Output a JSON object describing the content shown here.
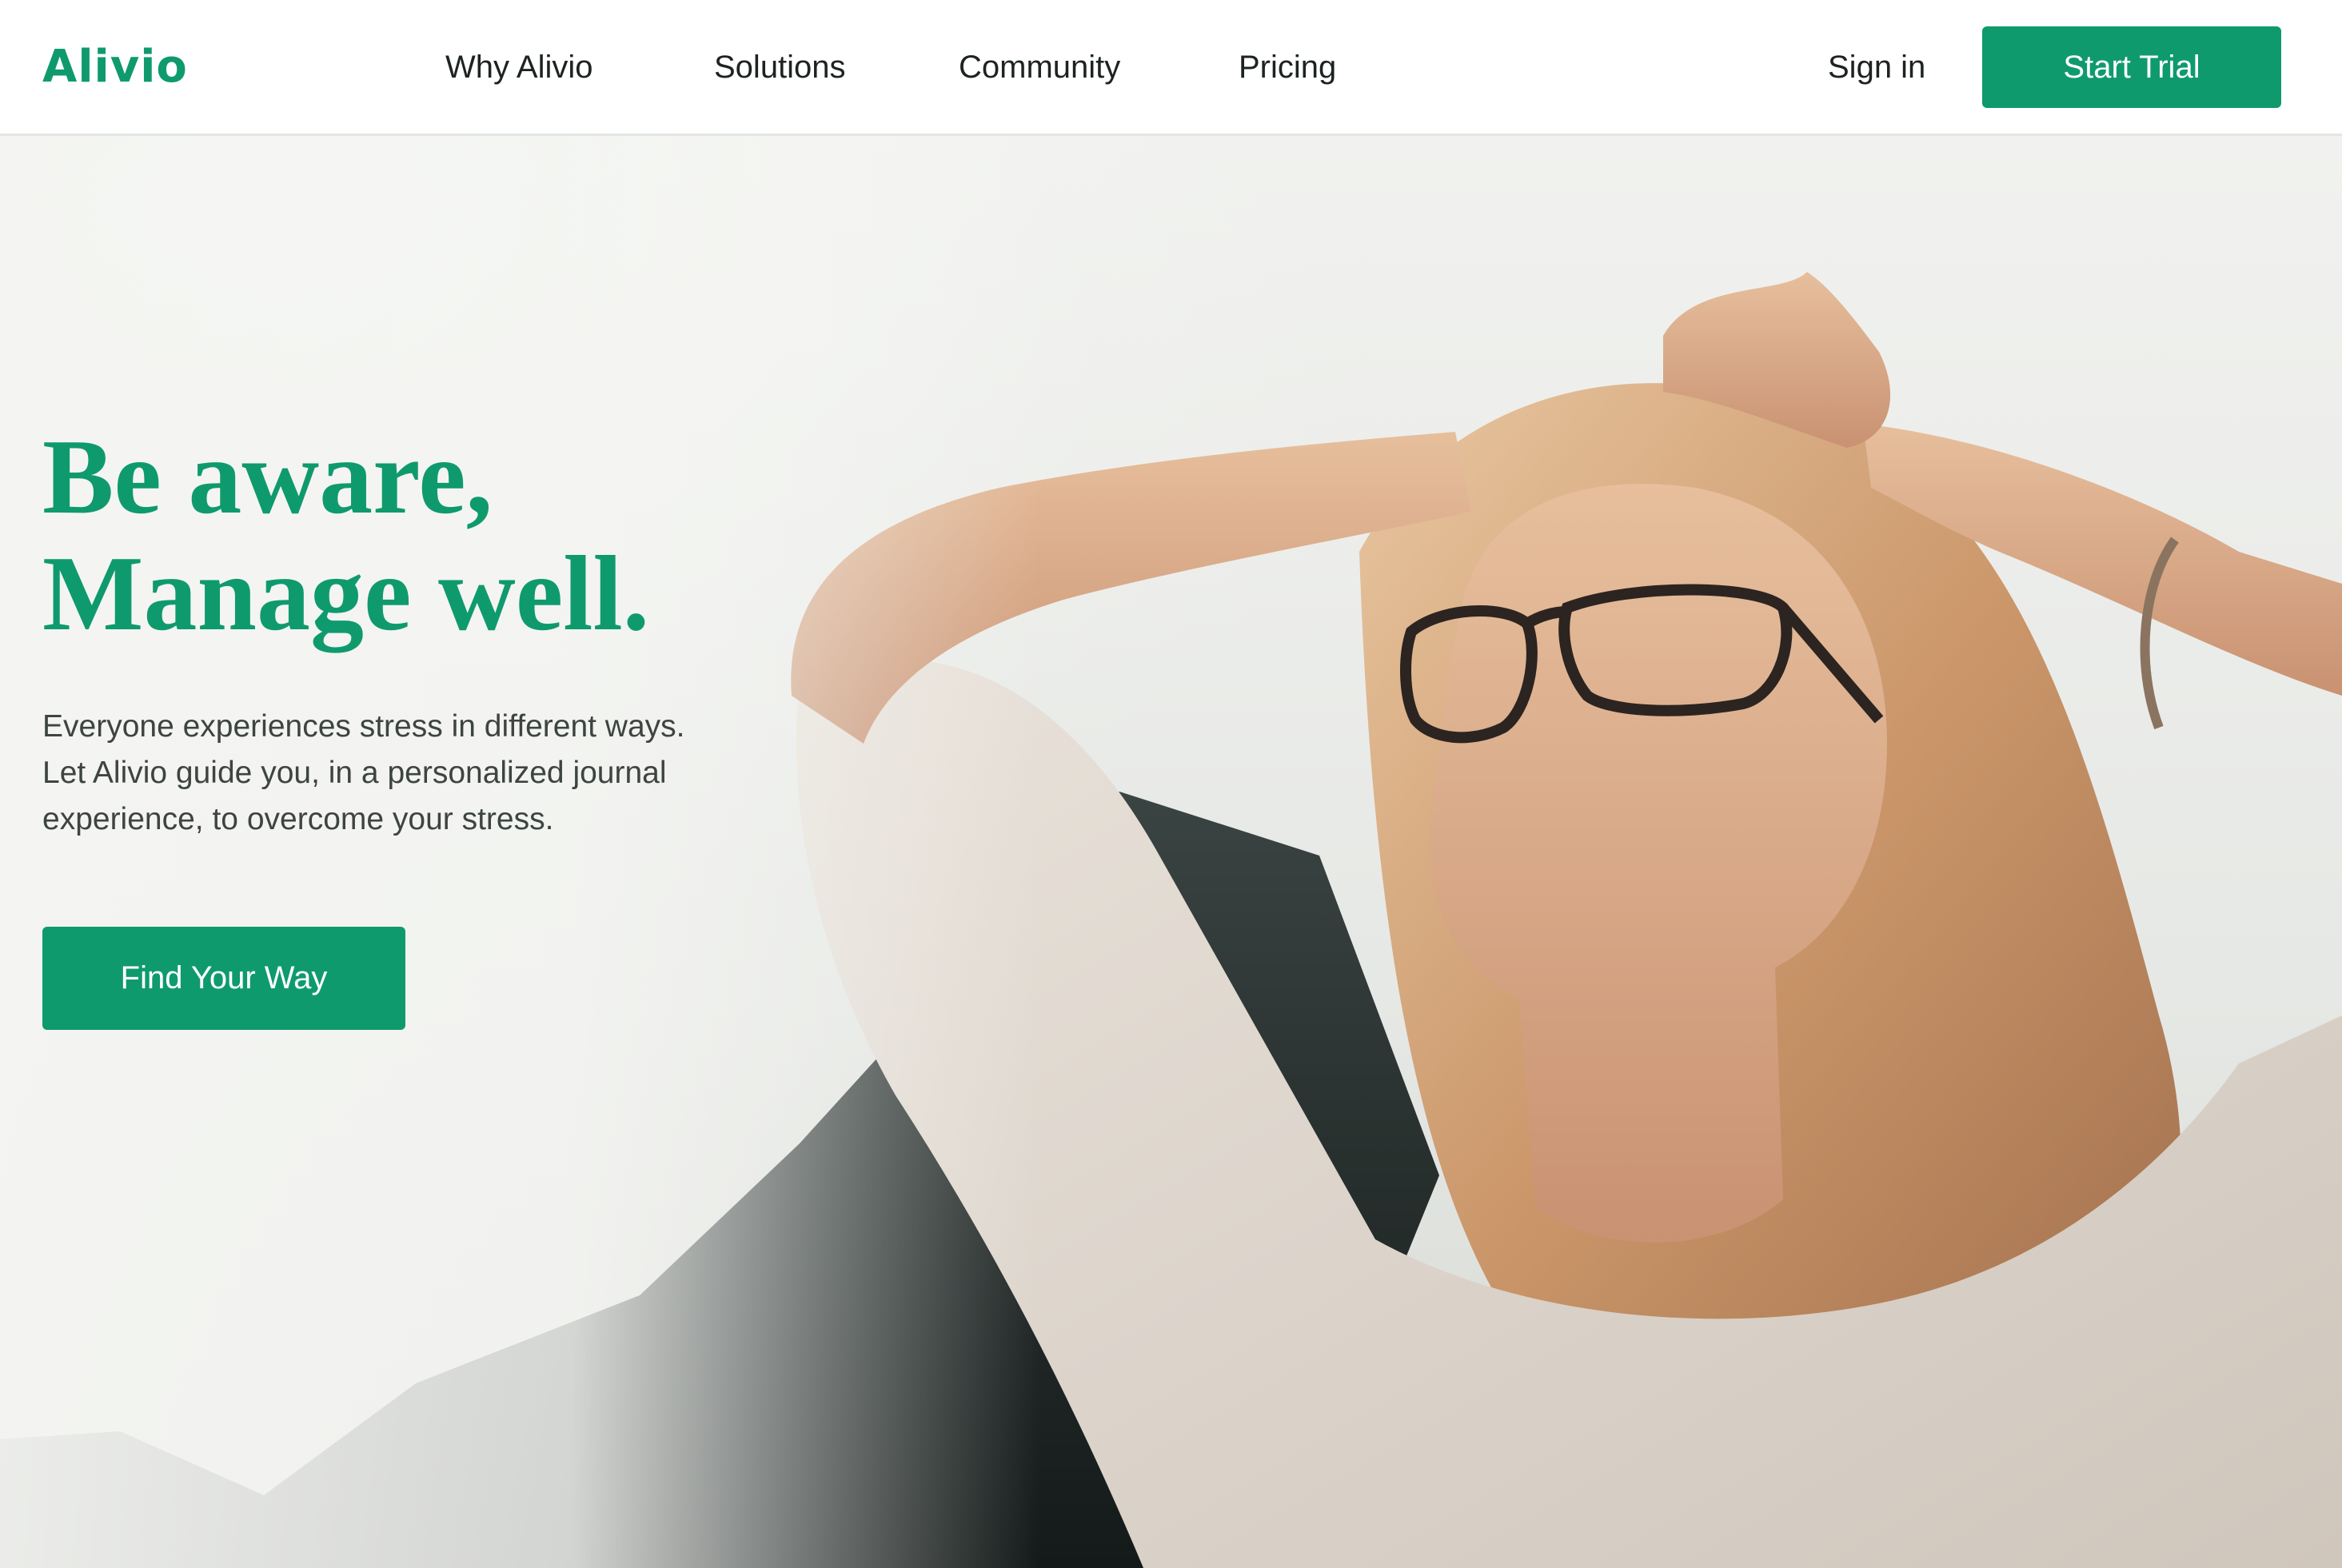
{
  "navbar": {
    "brand": "Alivio",
    "links": [
      "Why Alivio",
      "Solutions",
      "Community",
      "Pricing"
    ],
    "sign_in": "Sign in",
    "cta": "Start Trial"
  },
  "hero": {
    "title_line1": "Be aware,",
    "title_line2": "Manage well.",
    "description_lines": [
      "Everyone experiences stress in different ways.",
      "Let Alivio guide you, in a personalized journal",
      "experience, to overcome your stress."
    ],
    "cta": "Find Your Way",
    "image_subject": "woman-with-glasses-relaxing-in-sunlight"
  },
  "colors": {
    "brand": "#0f9a6e",
    "text": "#1d2321",
    "muted": "#3d4441"
  }
}
